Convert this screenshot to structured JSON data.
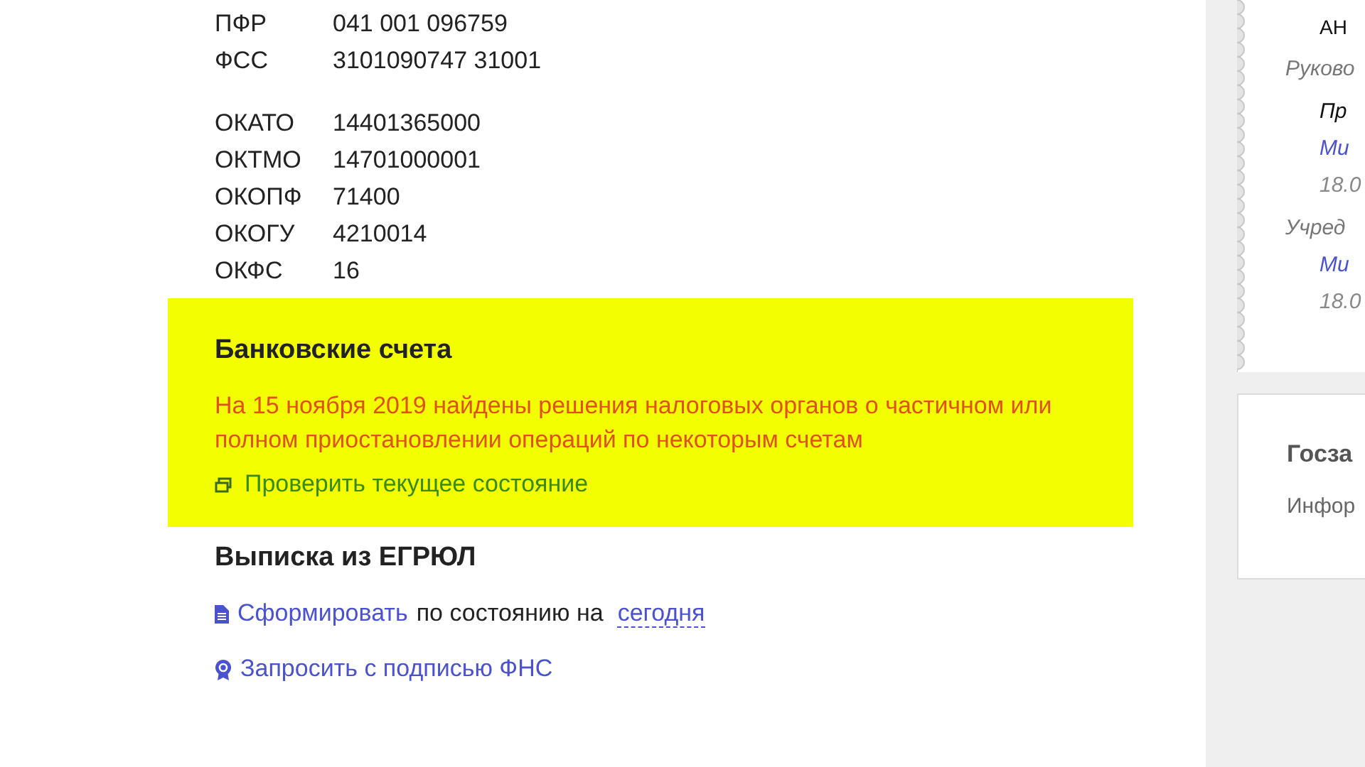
{
  "codes_top": [
    {
      "label": "ПФР",
      "value": "041 001 096759"
    },
    {
      "label": "ФСС",
      "value": "3101090747 31001"
    }
  ],
  "codes": [
    {
      "label": "ОКАТО",
      "value": "14401365000"
    },
    {
      "label": "ОКТМО",
      "value": "14701000001"
    },
    {
      "label": "ОКОПФ",
      "value": "71400"
    },
    {
      "label": "ОКОГУ",
      "value": "4210014"
    },
    {
      "label": "ОКФС",
      "value": "16"
    }
  ],
  "bank_accounts": {
    "title": "Банковские счета",
    "warning": "На 15 ноября 2019 найдены решения налоговых органов о частичном или полном приостановлении операций по некоторым счетам",
    "check_link": "Проверить текущее состояние"
  },
  "egrul": {
    "title": "Выписка из ЕГРЮЛ",
    "generate_link": "Сформировать",
    "generate_text": "по состоянию на",
    "date_link": "сегодня",
    "signed_link": "Запросить с подписью ФНС"
  },
  "sidebar": {
    "card": [
      {
        "kind": "name",
        "text": "АН"
      },
      {
        "kind": "heading",
        "text": "Руково"
      },
      {
        "kind": "role",
        "text": "Пр"
      },
      {
        "kind": "link",
        "text": "Ми"
      },
      {
        "kind": "date",
        "text": "18.0"
      },
      {
        "kind": "heading",
        "text": "Учред"
      },
      {
        "kind": "link",
        "text": "Ми"
      },
      {
        "kind": "date",
        "text": "18.0"
      }
    ],
    "procurement": {
      "title": "Госза",
      "text": "Инфор"
    }
  }
}
